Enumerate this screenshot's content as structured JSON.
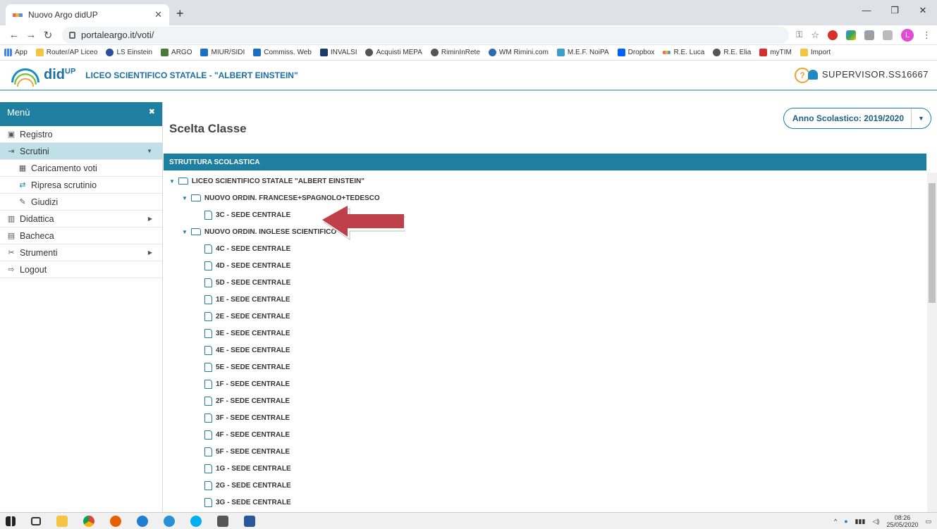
{
  "browser": {
    "tab_title": "Nuovo Argo didUP",
    "url": "portaleargo.it/voti/",
    "bookmarks": [
      "App",
      "Router/AP Liceo",
      "LS Einstein",
      "ARGO",
      "MIUR/SIDI",
      "Commiss. Web",
      "INVALSI",
      "Acquisti MEPA",
      "RiminInRete",
      "WM Rimini.com",
      "M.E.F. NoiPA",
      "Dropbox",
      "R.E. Luca",
      "R.E. Elia",
      "myTIM",
      "Import"
    ],
    "avatar_letter": "L"
  },
  "header": {
    "logo": "did",
    "logo_sup": "UP",
    "school": "LICEO SCIENTIFICO STATALE - \"ALBERT EINSTEIN\"",
    "help": "?",
    "user": "SUPERVISOR.SS16667"
  },
  "sidebar": {
    "title": "Menù",
    "close": "✖",
    "items": [
      {
        "label": "Registro"
      },
      {
        "label": "Scrutini"
      },
      {
        "label": "Caricamento voti"
      },
      {
        "label": "Ripresa scrutinio"
      },
      {
        "label": "Giudizi"
      },
      {
        "label": "Didattica"
      },
      {
        "label": "Bacheca"
      },
      {
        "label": "Strumenti"
      },
      {
        "label": "Logout"
      }
    ]
  },
  "content": {
    "title": "Scelta Classe",
    "year": "Anno Scolastico: 2019/2020",
    "struct_header": "STRUTTURA SCOLASTICA",
    "root": "LICEO SCIENTIFICO STATALE \"ALBERT EINSTEIN\"",
    "group1": "NUOVO ORDIN. FRANCESE+SPAGNOLO+TEDESCO",
    "group1_classes": [
      "3C - SEDE CENTRALE"
    ],
    "group2": "NUOVO ORDIN. INGLESE SCIENTIFICO",
    "group2_classes": [
      "4C - SEDE CENTRALE",
      "4D - SEDE CENTRALE",
      "5D - SEDE CENTRALE",
      "1E - SEDE CENTRALE",
      "2E - SEDE CENTRALE",
      "3E - SEDE CENTRALE",
      "4E - SEDE CENTRALE",
      "5E - SEDE CENTRALE",
      "1F - SEDE CENTRALE",
      "2F - SEDE CENTRALE",
      "3F - SEDE CENTRALE",
      "4F - SEDE CENTRALE",
      "5F - SEDE CENTRALE",
      "1G - SEDE CENTRALE",
      "2G - SEDE CENTRALE",
      "3G - SEDE CENTRALE"
    ]
  },
  "taskbar": {
    "time": "08:26",
    "date": "25/05/2020"
  }
}
